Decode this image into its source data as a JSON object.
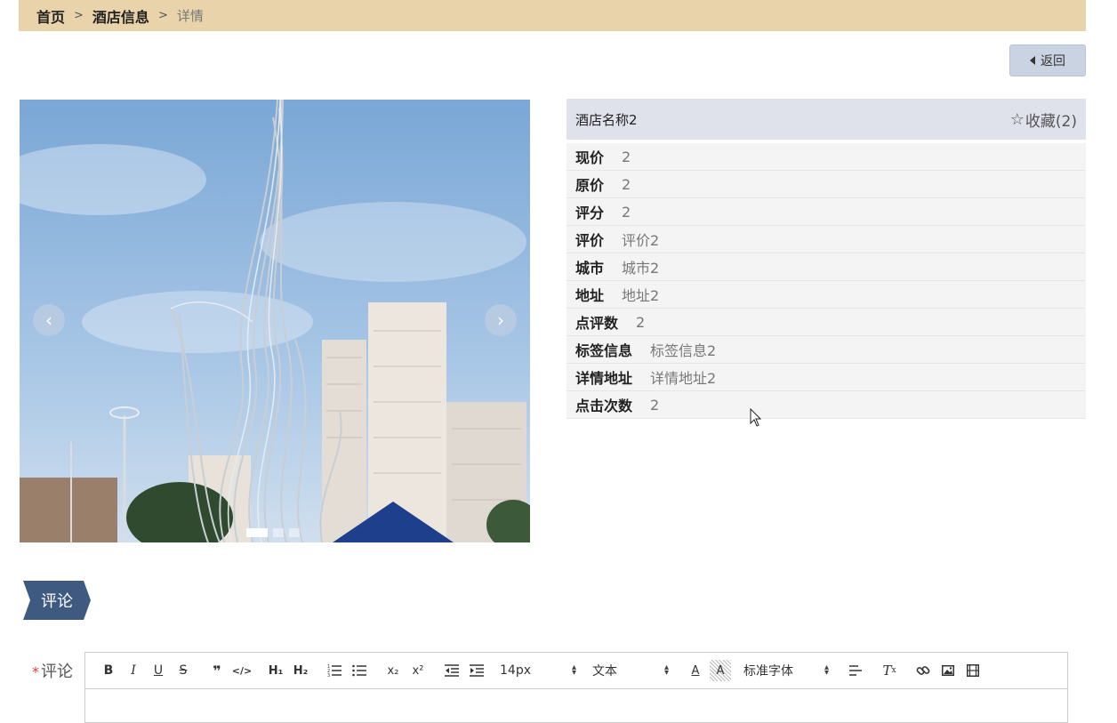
{
  "breadcrumb": {
    "home": "首页",
    "sep1": ">",
    "section": "酒店信息",
    "sep2": ">",
    "current": "详情"
  },
  "back_button": {
    "label": "返回"
  },
  "carousel": {
    "prev": "‹",
    "next": "›",
    "slide_count": 3,
    "active_index": 0
  },
  "hotel": {
    "title": "酒店名称2",
    "favorite_label": "收藏(2)",
    "fields": [
      {
        "label": "现价",
        "value": "2"
      },
      {
        "label": "原价",
        "value": "2"
      },
      {
        "label": "评分",
        "value": "2"
      },
      {
        "label": "评价",
        "value": "评价2"
      },
      {
        "label": "城市",
        "value": "城市2"
      },
      {
        "label": "地址",
        "value": "地址2"
      },
      {
        "label": "点评数",
        "value": "2"
      },
      {
        "label": "标签信息",
        "value": "标签信息2"
      },
      {
        "label": "详情地址",
        "value": "详情地址2"
      },
      {
        "label": "点击次数",
        "value": "2"
      }
    ]
  },
  "comments": {
    "section_title": "评论",
    "field_label": "评论",
    "required_mark": "*",
    "toolbar": {
      "size": "14px",
      "format": "文本",
      "font": "标准字体"
    }
  },
  "colors": {
    "breadcrumb_bg": "#e9d3ab",
    "back_button_bg": "#c9d3e2",
    "section_tag_bg": "#3f5a80"
  }
}
